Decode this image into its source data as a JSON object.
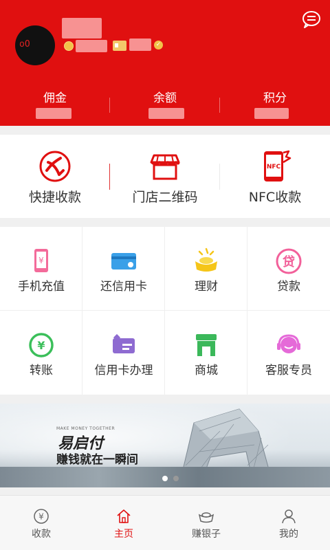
{
  "header": {
    "stats": [
      {
        "label": "佣金"
      },
      {
        "label": "余额"
      },
      {
        "label": "积分"
      }
    ],
    "message_icon": "chat-bubble-icon",
    "brand_color": "#e01010"
  },
  "quick_actions": [
    {
      "label": "快捷收款",
      "icon": "swallow-logo-icon"
    },
    {
      "label": "门店二维码",
      "icon": "storefront-icon"
    },
    {
      "label": "NFC收款",
      "icon": "nfc-phone-icon"
    }
  ],
  "services": [
    {
      "label": "手机充值",
      "icon": "phone-recharge-icon",
      "color": "#f36b9a"
    },
    {
      "label": "还信用卡",
      "icon": "credit-card-icon",
      "color": "#3aa0e8"
    },
    {
      "label": "理财",
      "icon": "gold-ingot-icon",
      "color": "#f5c518"
    },
    {
      "label": "贷款",
      "icon": "loan-icon",
      "color": "#f2609a"
    },
    {
      "label": "转账",
      "icon": "transfer-icon",
      "color": "#3bbf5a"
    },
    {
      "label": "信用卡办理",
      "icon": "apply-card-icon",
      "color": "#8e6bd1"
    },
    {
      "label": "商城",
      "icon": "shop-icon",
      "color": "#3bb85a"
    },
    {
      "label": "客服专员",
      "icon": "customer-service-icon",
      "color": "#e56ad8"
    }
  ],
  "banner": {
    "tagline_en": "MAKE MONEY TOGETHER",
    "brand": "易启付",
    "slogan": "赚钱就在一瞬间",
    "page_count": 2,
    "active_page": 1
  },
  "tabbar": {
    "items": [
      {
        "label": "收款",
        "icon": "yen-circle-icon"
      },
      {
        "label": "主页",
        "icon": "home-icon"
      },
      {
        "label": "赚银子",
        "icon": "silver-ingot-icon"
      },
      {
        "label": "我的",
        "icon": "user-icon"
      }
    ],
    "active_index": 1,
    "active_color": "#e01010"
  }
}
